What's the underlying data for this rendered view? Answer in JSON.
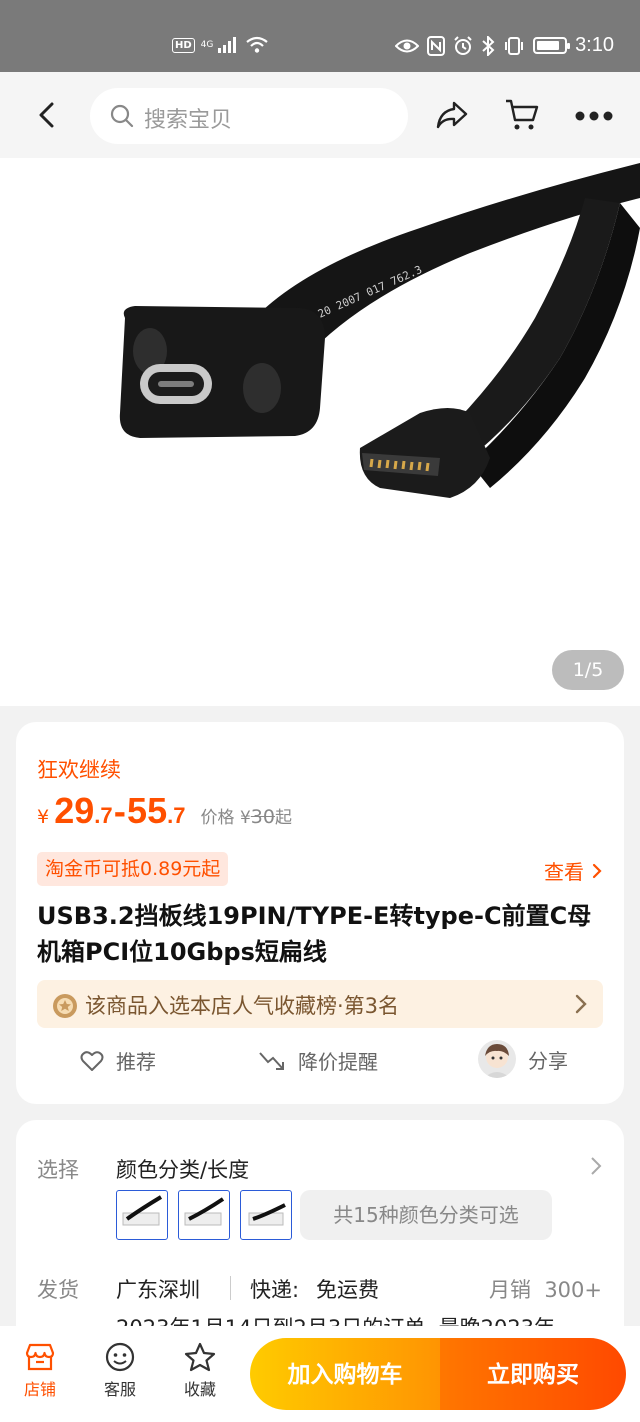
{
  "status_bar": {
    "hd": "HD",
    "network": "4G",
    "time": "3:10",
    "battery_level": 0.85,
    "icons": [
      "signal-icon",
      "wifi-icon",
      "eye-icon",
      "nfc-icon",
      "alarm-icon",
      "bluetooth-icon",
      "vibrate-icon",
      "battery-icon"
    ]
  },
  "nav": {
    "search_placeholder": "搜索宝贝",
    "icons": [
      "back-icon",
      "search-icon",
      "share-icon",
      "cart-icon",
      "more-icon"
    ]
  },
  "gallery": {
    "counter": "1/5"
  },
  "product": {
    "promo_tag": "狂欢继续",
    "currency": "¥",
    "price_low_int": "29",
    "price_low_dec": ".7",
    "price_dash": "-",
    "price_high_int": "55",
    "price_high_dec": ".7",
    "orig_label": "价格",
    "orig_currency": "¥",
    "orig_price": "30",
    "orig_suffix": "起",
    "coin_badge": "淘金币可抵0.89元起",
    "check_link": "查看",
    "title": "USB3.2挡板线19PIN/TYPE-E转type-C前置C母机箱PCI位10Gbps短扁线",
    "rank_text": "该商品入选本店人气收藏榜·第3名",
    "actions": {
      "recommend": "推荐",
      "price_alert": "降价提醒",
      "share": "分享"
    }
  },
  "options": {
    "select_label": "选择",
    "select_title": "颜色分类/长度",
    "variant_count": "共15种颜色分类可选",
    "ship_label": "发货",
    "ship_origin": "广东深圳",
    "ship_method": "快递:",
    "ship_fee": "免运费",
    "monthly_label": "月销",
    "monthly_sales": "300+",
    "order_note": "2023年1月14日到2月3日的订单, 最晚2023年"
  },
  "bottom": {
    "store": "店铺",
    "service": "客服",
    "favorite": "收藏",
    "add_to_cart": "加入购物车",
    "buy_now": "立即购买"
  },
  "colors": {
    "accent": "#ff5000",
    "cart_button": "#ffb000",
    "buy_button": "#ff5a00",
    "status_bar": "#7a7a7a"
  }
}
